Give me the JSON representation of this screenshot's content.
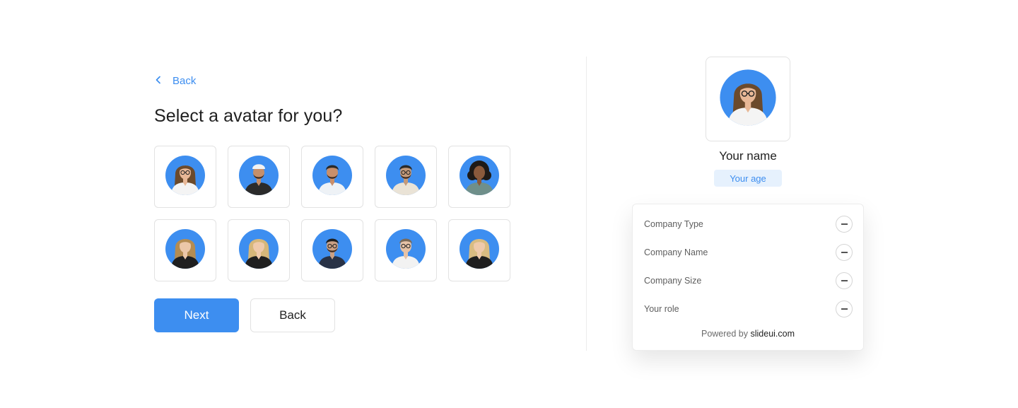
{
  "colors": {
    "accent": "#3d8ef0",
    "avatar_bg": "#3d8ef0",
    "badge_bg": "#e6f1fd"
  },
  "nav": {
    "back_label": "Back",
    "back_icon": "chevron-left-icon"
  },
  "title": "Select a avatar for you?",
  "avatars": [
    {
      "id": "avatar-1",
      "hair": "#6b4a2c",
      "hair_style": "long",
      "skin": "#e8b897",
      "shirt": "#f4f4f4",
      "glasses": true,
      "beard": false
    },
    {
      "id": "avatar-2",
      "hair": "#f2f2f2",
      "hair_style": "cap",
      "skin": "#c68f6a",
      "shirt": "#2b2b2b",
      "glasses": false,
      "beard": true
    },
    {
      "id": "avatar-3",
      "hair": "#2a2a2a",
      "hair_style": "short",
      "skin": "#c98f6a",
      "shirt": "#eef2f6",
      "glasses": false,
      "beard": true
    },
    {
      "id": "avatar-4",
      "hair": "#2a2a2a",
      "hair_style": "short",
      "skin": "#c49a7a",
      "shirt": "#eae3d6",
      "glasses": true,
      "beard": true
    },
    {
      "id": "avatar-5",
      "hair": "#1e1a17",
      "hair_style": "curly",
      "skin": "#8a5a3c",
      "shirt": "#6f8f8a",
      "glasses": false,
      "beard": false
    },
    {
      "id": "avatar-6",
      "hair": "#b48c52",
      "hair_style": "long",
      "skin": "#ecc7a8",
      "shirt": "#1f1f1f",
      "glasses": false,
      "beard": false
    },
    {
      "id": "avatar-7",
      "hair": "#d6b77a",
      "hair_style": "long",
      "skin": "#efcaab",
      "shirt": "#1f1f1f",
      "glasses": false,
      "beard": false
    },
    {
      "id": "avatar-8",
      "hair": "#1e1e1e",
      "hair_style": "short",
      "skin": "#caa084",
      "shirt": "#283246",
      "glasses": true,
      "beard": true
    },
    {
      "id": "avatar-9",
      "hair": "#7b6a58",
      "hair_style": "short",
      "skin": "#e6c2a6",
      "shirt": "#f2f2f2",
      "glasses": true,
      "beard": false
    },
    {
      "id": "avatar-10",
      "hair": "#d9bc82",
      "hair_style": "long",
      "skin": "#efcaab",
      "shirt": "#1f1f1f",
      "glasses": false,
      "beard": false
    }
  ],
  "buttons": {
    "next": "Next",
    "back": "Back"
  },
  "preview": {
    "avatar": {
      "hair": "#6b4a2c",
      "hair_style": "long",
      "skin": "#e8b897",
      "shirt": "#f4f4f4",
      "glasses": true,
      "beard": false
    },
    "name": "Your name",
    "age": "Your age"
  },
  "fields": [
    {
      "label": "Company Type",
      "icon": "minus-icon"
    },
    {
      "label": "Company Name",
      "icon": "minus-icon"
    },
    {
      "label": "Company Size",
      "icon": "minus-icon"
    },
    {
      "label": "Your role",
      "icon": "minus-icon"
    }
  ],
  "footer": {
    "prefix": "Powered by",
    "brand": "slideui.com"
  }
}
